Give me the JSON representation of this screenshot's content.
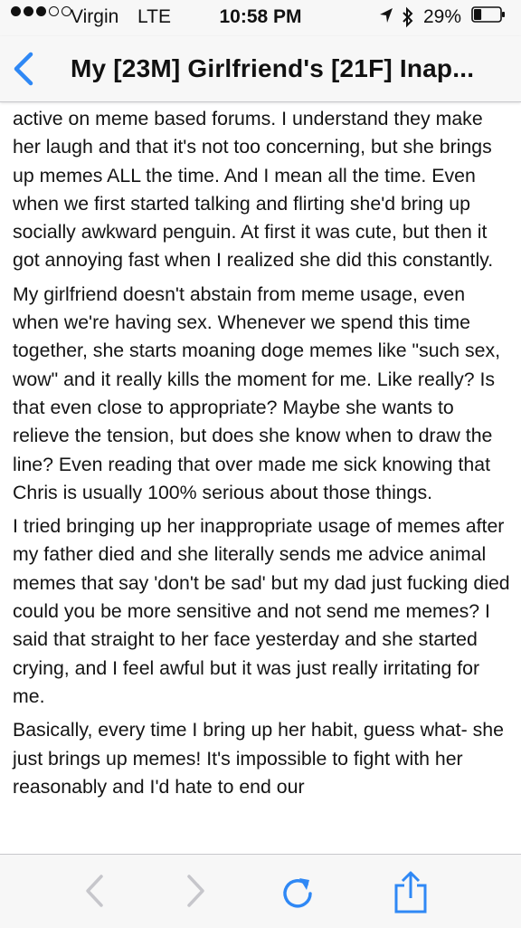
{
  "status_bar": {
    "carrier": "Virgin",
    "network": "LTE",
    "time": "10:58 PM",
    "battery_percent": "29%",
    "battery_level": 0.29,
    "signal_bars_filled": 3,
    "signal_bars_total": 5
  },
  "navbar": {
    "title": "My [23M] Girlfriend's [21F] Inap..."
  },
  "article": {
    "paragraphs": [
      "active on meme based forums. I understand they make her laugh and that it's not too concerning, but she brings up memes ALL the time. And I mean all the time. Even when we first started talking and flirting she'd bring up socially awkward penguin. At first it was cute, but then it got annoying fast when I realized she did this constantly.",
      "My girlfriend doesn't abstain from meme usage, even when we're having sex. Whenever we spend this time together, she starts moaning doge memes like \"such sex, wow\" and it really kills the moment for me. Like really? Is that even close to appropriate? Maybe she wants to relieve the tension, but does she know when to draw the line? Even reading that over made me sick knowing that Chris is usually 100% serious about those things.",
      "I tried bringing up her inappropriate usage of memes after my father died and she literally sends me advice animal memes that say 'don't be sad' but my dad just fucking died could you be more sensitive and not send me memes? I said that straight to her face yesterday and she started crying, and I feel awful but it was just really irritating for me.",
      "Basically, every time I bring up her habit, guess what- she just brings up memes! It's impossible to fight with her reasonably and I'd hate to end our"
    ]
  },
  "toolbar": {
    "back_icon": "chevron-left-icon",
    "forward_icon": "chevron-right-icon",
    "reload_icon": "reload-icon",
    "share_icon": "share-icon"
  },
  "colors": {
    "accent": "#2f88f5",
    "toolbar_disabled": "#c6c6cb",
    "bar_background": "#f7f7f7",
    "text": "#141414"
  }
}
